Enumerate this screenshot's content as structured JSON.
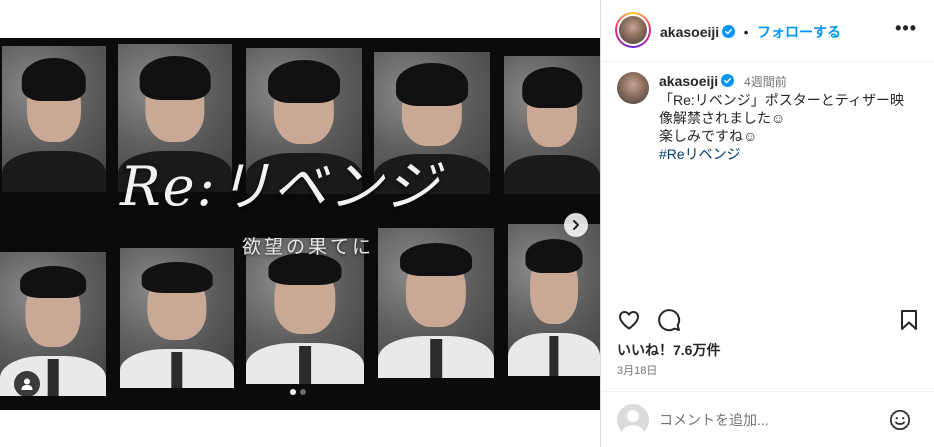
{
  "post": {
    "image": {
      "title_text": "Re:リベンジ",
      "subtitle_text": "欲望の果てに",
      "carousel_total": 2,
      "carousel_active": 1
    }
  },
  "header": {
    "username": "akasoeiji",
    "separator": "•",
    "follow_label": "フォローする",
    "more_label": "•••"
  },
  "caption": {
    "username": "akasoeiji",
    "time": "4週間前",
    "line1": "「Re:リベンジ」ポスターとティザー映像解禁されました☺",
    "line2": "楽しみですね☺",
    "hashtag": "#Reリベンジ"
  },
  "stats": {
    "likes": "いいね！7.6万件",
    "date": "3月18日"
  },
  "comment": {
    "placeholder": "コメントを追加..."
  },
  "icons": {
    "verified": "verified-badge-icon",
    "like": "heart-icon",
    "comment": "comment-bubble-icon",
    "save": "bookmark-icon",
    "emoji": "emoji-icon",
    "next": "chevron-right-icon",
    "tag": "user-tag-icon"
  },
  "colors": {
    "accent": "#0095f6",
    "verified": "#0095f6",
    "hashtag": "#00376b"
  }
}
